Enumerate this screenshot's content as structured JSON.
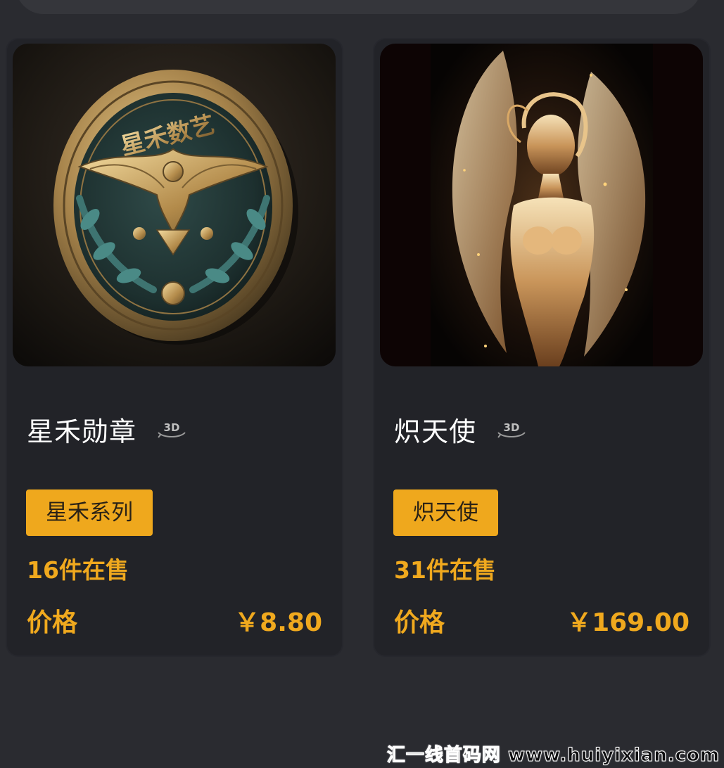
{
  "cards": [
    {
      "title": "星禾勋章",
      "badge": "3D",
      "series": "星禾系列",
      "on_sale": "16件在售",
      "price_label": "价格",
      "price": "￥8.80",
      "image": "coin-medal-image"
    },
    {
      "title": "炽天使",
      "badge": "3D",
      "series": "炽天使",
      "on_sale": "31件在售",
      "price_label": "价格",
      "price": "￥169.00",
      "image": "golden-angel-image"
    }
  ],
  "watermark": "汇一线首码网 www.huiyixian.com",
  "colors": {
    "background": "#2a2b30",
    "card": "#222328",
    "accent": "#f0a91e",
    "title_text": "#ffffff"
  },
  "coin_text": "星禾数艺"
}
